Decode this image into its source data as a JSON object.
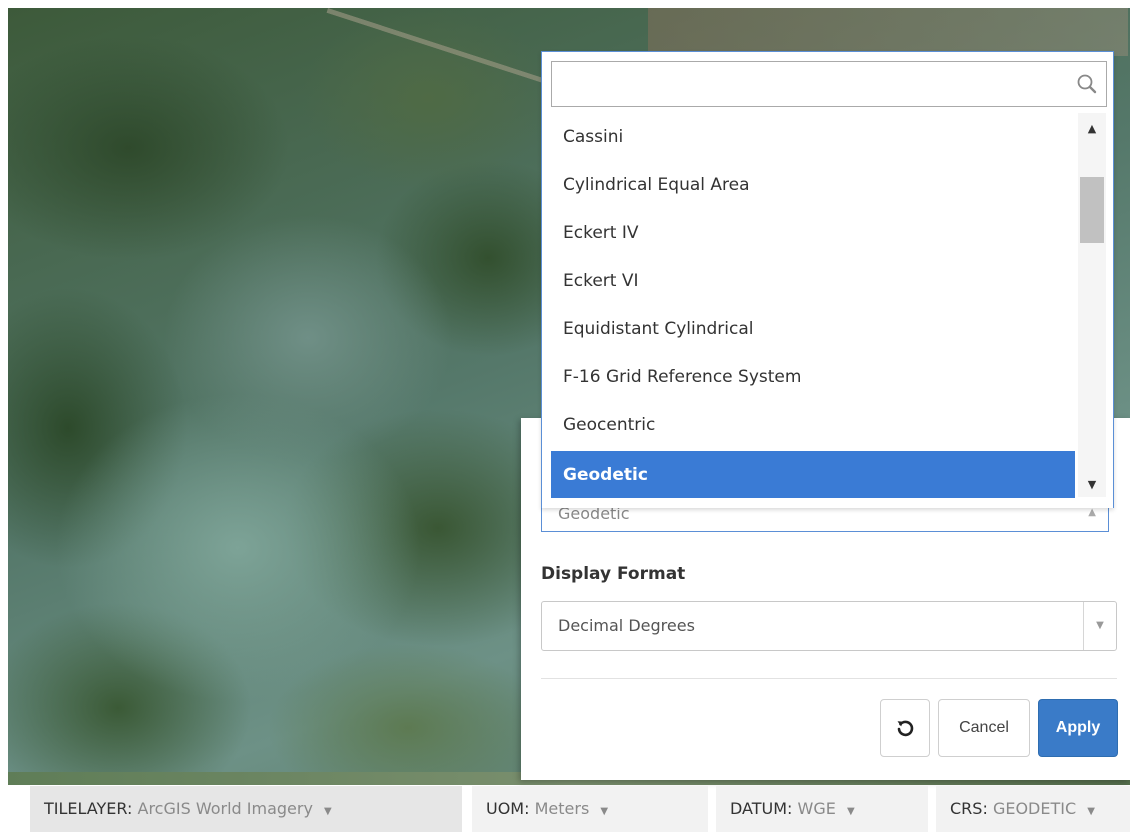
{
  "dropdown": {
    "search_placeholder": "",
    "options": [
      "Cassini",
      "Cylindrical Equal Area",
      "Eckert IV",
      "Eckert VI",
      "Equidistant Cylindrical",
      "F-16 Grid Reference System",
      "Geocentric",
      "Geodetic"
    ],
    "selected": "Geodetic",
    "selected_color": "#3a7bd5",
    "icons": {
      "search": "search-icon",
      "scroll_up": "triangle-up-icon",
      "scroll_down": "triangle-down-icon"
    }
  },
  "crs_select": {
    "value": "Geodetic",
    "arrow": "▲"
  },
  "display_format": {
    "label": "Display Format",
    "value": "Decimal Degrees",
    "arrow": "▼"
  },
  "buttons": {
    "reset_icon": "reset-icon",
    "cancel": "Cancel",
    "apply": "Apply",
    "apply_color": "#3a7bc8"
  },
  "statusbar": {
    "tilelayer": {
      "label": "TILELAYER:",
      "value": "ArcGIS World Imagery"
    },
    "uom": {
      "label": "UOM:",
      "value": "Meters"
    },
    "datum": {
      "label": "DATUM:",
      "value": "WGE"
    },
    "crs": {
      "label": "CRS:",
      "value": "GEODETIC"
    },
    "caret": "▼"
  }
}
